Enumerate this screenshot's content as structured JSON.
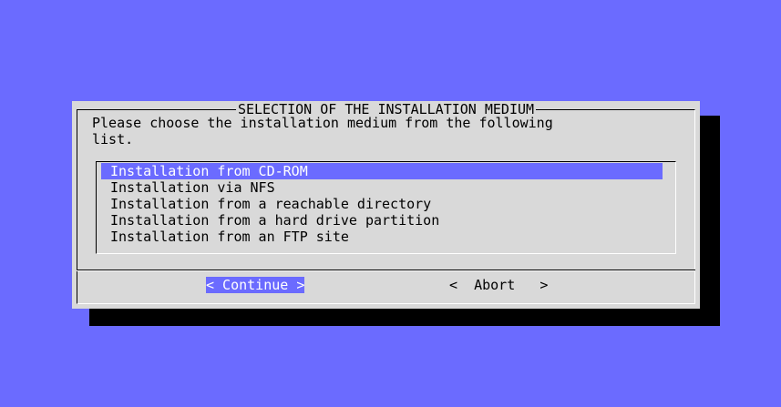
{
  "colors": {
    "background": "#6b6bff",
    "dialog": "#d9d9d9",
    "highlight": "#6b6bff",
    "shadow": "#000000"
  },
  "dialog": {
    "title": "SELECTION OF THE INSTALLATION MEDIUM",
    "prompt": "Please choose the installation medium from the following\nlist.",
    "items": [
      {
        "label": "Installation from CD-ROM",
        "selected": true
      },
      {
        "label": "Installation via NFS",
        "selected": false
      },
      {
        "label": "Installation from a reachable directory",
        "selected": false
      },
      {
        "label": "Installation from a hard drive partition",
        "selected": false
      },
      {
        "label": "Installation from an FTP site",
        "selected": false
      }
    ],
    "buttons": {
      "continue": "< Continue >",
      "abort": "<  Abort   >"
    }
  }
}
